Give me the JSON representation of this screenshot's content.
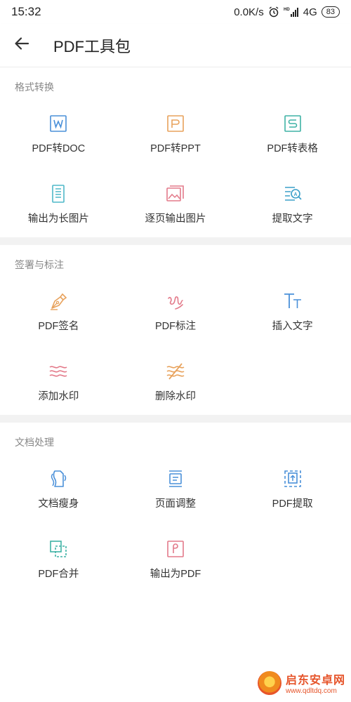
{
  "status_bar": {
    "time": "15:32",
    "network_speed": "0.0K/s",
    "signal_label": "HD",
    "network_type": "4G",
    "battery": "83"
  },
  "header": {
    "title": "PDF工具包"
  },
  "sections": [
    {
      "title": "格式转换",
      "tools": [
        {
          "label": "PDF转DOC",
          "icon": "doc-word-icon",
          "color": "#4a90d9"
        },
        {
          "label": "PDF转PPT",
          "icon": "ppt-icon",
          "color": "#e8a25c"
        },
        {
          "label": "PDF转表格",
          "icon": "sheet-icon",
          "color": "#3fb2a5"
        },
        {
          "label": "输出为长图片",
          "icon": "long-image-icon",
          "color": "#4fb8c8"
        },
        {
          "label": "逐页输出图片",
          "icon": "page-image-icon",
          "color": "#e37a8a"
        },
        {
          "label": "提取文字",
          "icon": "extract-text-icon",
          "color": "#3a9fc9"
        }
      ]
    },
    {
      "title": "签署与标注",
      "tools": [
        {
          "label": "PDF签名",
          "icon": "pen-nib-icon",
          "color": "#e8a25c"
        },
        {
          "label": "PDF标注",
          "icon": "scribble-icon",
          "color": "#e37a8a"
        },
        {
          "label": "插入文字",
          "icon": "text-tt-icon",
          "color": "#4a90d9"
        },
        {
          "label": "添加水印",
          "icon": "watermark-waves-icon",
          "color": "#e37a8a"
        },
        {
          "label": "删除水印",
          "icon": "remove-watermark-icon",
          "color": "#e8a25c"
        }
      ]
    },
    {
      "title": "文档处理",
      "tools": [
        {
          "label": "文档瘦身",
          "icon": "slim-doc-icon",
          "color": "#4a90d9"
        },
        {
          "label": "页面调整",
          "icon": "page-adjust-icon",
          "color": "#4a90d9"
        },
        {
          "label": "PDF提取",
          "icon": "pdf-extract-icon",
          "color": "#4a90d9"
        },
        {
          "label": "PDF合并",
          "icon": "merge-icon",
          "color": "#3fb2a5"
        },
        {
          "label": "输出为PDF",
          "icon": "export-pdf-icon",
          "color": "#e37a8a"
        }
      ]
    }
  ],
  "watermark": {
    "name": "启东安卓网",
    "url": "www.qdltdq.com"
  }
}
